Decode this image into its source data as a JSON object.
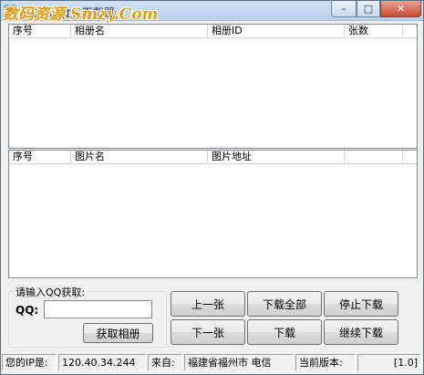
{
  "window": {
    "title": "QQ相册批量下载器",
    "watermark": "数码资源 Smzy.Com",
    "minimize_glyph": "–",
    "maximize_glyph": "□",
    "close_glyph": "✕"
  },
  "album_list": {
    "columns": [
      "序号",
      "相册名",
      "相册ID",
      "张数"
    ],
    "rows": []
  },
  "photo_list": {
    "columns": [
      "序号",
      "图片名",
      "图片地址",
      ""
    ],
    "rows": []
  },
  "qq_group": {
    "legend": "请输入QQ获取:",
    "qq_label": "QQ:",
    "qq_value": "",
    "fetch_button": "获取相册"
  },
  "buttons": {
    "prev": "上一张",
    "download_all": "下载全部",
    "stop_download": "停止下载",
    "next": "下一张",
    "download": "下载",
    "continue_download": "继续下载"
  },
  "status": {
    "ip_label": "您的IP是:",
    "ip_value": "120.40.34.244",
    "from_label": "来自:",
    "from_value": "福建省福州市 电信",
    "version_label": "当前版本:",
    "version_value": "[1.0]"
  }
}
